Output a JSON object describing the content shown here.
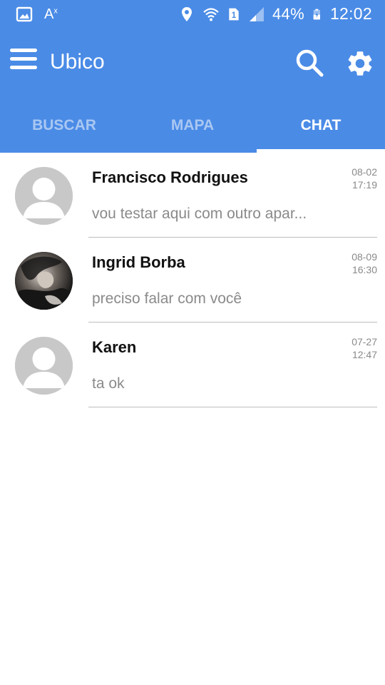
{
  "status_bar": {
    "battery": "44%",
    "time": "12:02",
    "sim_label": "1",
    "left_icons": [
      "image-icon",
      "translate-icon"
    ],
    "right_icons": [
      "location-icon",
      "wifi-icon",
      "sim-icon",
      "signal-icon",
      "battery-icon"
    ]
  },
  "app_bar": {
    "title": "Ubico",
    "icons": [
      "menu-icon",
      "search-icon",
      "settings-icon"
    ]
  },
  "tabs": [
    {
      "label": "BUSCAR",
      "active": false
    },
    {
      "label": "MAPA",
      "active": false
    },
    {
      "label": "CHAT",
      "active": true
    }
  ],
  "chats": [
    {
      "name": "Francisco Rodrigues",
      "message": "vou testar aqui com outro apar...",
      "date": "08-02",
      "time": "17:19",
      "avatar": "default-avatar-icon"
    },
    {
      "name": "Ingrid Borba",
      "message": "preciso falar com você",
      "date": "08-09",
      "time": "16:30",
      "avatar": "photo-avatar"
    },
    {
      "name": "Karen",
      "message": "ta ok",
      "date": "07-27",
      "time": "12:47",
      "avatar": "default-avatar-icon"
    }
  ],
  "colors": {
    "primary": "#4a8be6",
    "tab_inactive": "#a9c7f2",
    "text_secondary": "#8a8a8a",
    "avatar_placeholder": "#c8c8c8"
  }
}
